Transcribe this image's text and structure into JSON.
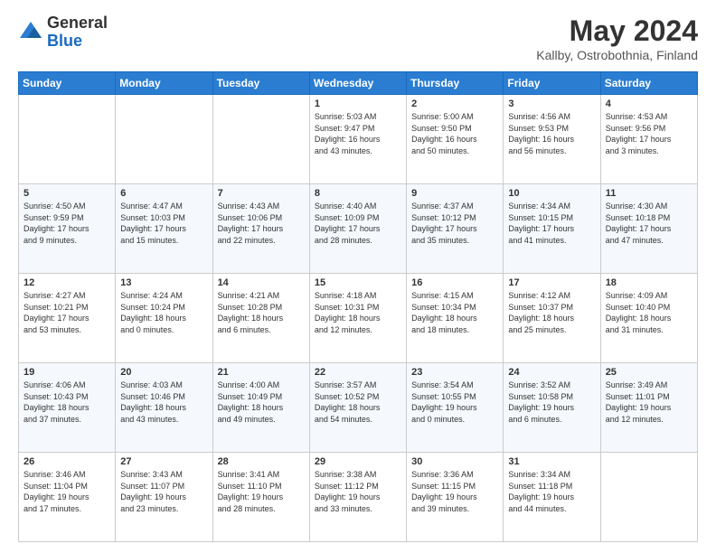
{
  "logo": {
    "general": "General",
    "blue": "Blue"
  },
  "title": "May 2024",
  "subtitle": "Kallby, Ostrobothnia, Finland",
  "days_of_week": [
    "Sunday",
    "Monday",
    "Tuesday",
    "Wednesday",
    "Thursday",
    "Friday",
    "Saturday"
  ],
  "weeks": [
    [
      {
        "day": "",
        "info": ""
      },
      {
        "day": "",
        "info": ""
      },
      {
        "day": "",
        "info": ""
      },
      {
        "day": "1",
        "info": "Sunrise: 5:03 AM\nSunset: 9:47 PM\nDaylight: 16 hours\nand 43 minutes."
      },
      {
        "day": "2",
        "info": "Sunrise: 5:00 AM\nSunset: 9:50 PM\nDaylight: 16 hours\nand 50 minutes."
      },
      {
        "day": "3",
        "info": "Sunrise: 4:56 AM\nSunset: 9:53 PM\nDaylight: 16 hours\nand 56 minutes."
      },
      {
        "day": "4",
        "info": "Sunrise: 4:53 AM\nSunset: 9:56 PM\nDaylight: 17 hours\nand 3 minutes."
      }
    ],
    [
      {
        "day": "5",
        "info": "Sunrise: 4:50 AM\nSunset: 9:59 PM\nDaylight: 17 hours\nand 9 minutes."
      },
      {
        "day": "6",
        "info": "Sunrise: 4:47 AM\nSunset: 10:03 PM\nDaylight: 17 hours\nand 15 minutes."
      },
      {
        "day": "7",
        "info": "Sunrise: 4:43 AM\nSunset: 10:06 PM\nDaylight: 17 hours\nand 22 minutes."
      },
      {
        "day": "8",
        "info": "Sunrise: 4:40 AM\nSunset: 10:09 PM\nDaylight: 17 hours\nand 28 minutes."
      },
      {
        "day": "9",
        "info": "Sunrise: 4:37 AM\nSunset: 10:12 PM\nDaylight: 17 hours\nand 35 minutes."
      },
      {
        "day": "10",
        "info": "Sunrise: 4:34 AM\nSunset: 10:15 PM\nDaylight: 17 hours\nand 41 minutes."
      },
      {
        "day": "11",
        "info": "Sunrise: 4:30 AM\nSunset: 10:18 PM\nDaylight: 17 hours\nand 47 minutes."
      }
    ],
    [
      {
        "day": "12",
        "info": "Sunrise: 4:27 AM\nSunset: 10:21 PM\nDaylight: 17 hours\nand 53 minutes."
      },
      {
        "day": "13",
        "info": "Sunrise: 4:24 AM\nSunset: 10:24 PM\nDaylight: 18 hours\nand 0 minutes."
      },
      {
        "day": "14",
        "info": "Sunrise: 4:21 AM\nSunset: 10:28 PM\nDaylight: 18 hours\nand 6 minutes."
      },
      {
        "day": "15",
        "info": "Sunrise: 4:18 AM\nSunset: 10:31 PM\nDaylight: 18 hours\nand 12 minutes."
      },
      {
        "day": "16",
        "info": "Sunrise: 4:15 AM\nSunset: 10:34 PM\nDaylight: 18 hours\nand 18 minutes."
      },
      {
        "day": "17",
        "info": "Sunrise: 4:12 AM\nSunset: 10:37 PM\nDaylight: 18 hours\nand 25 minutes."
      },
      {
        "day": "18",
        "info": "Sunrise: 4:09 AM\nSunset: 10:40 PM\nDaylight: 18 hours\nand 31 minutes."
      }
    ],
    [
      {
        "day": "19",
        "info": "Sunrise: 4:06 AM\nSunset: 10:43 PM\nDaylight: 18 hours\nand 37 minutes."
      },
      {
        "day": "20",
        "info": "Sunrise: 4:03 AM\nSunset: 10:46 PM\nDaylight: 18 hours\nand 43 minutes."
      },
      {
        "day": "21",
        "info": "Sunrise: 4:00 AM\nSunset: 10:49 PM\nDaylight: 18 hours\nand 49 minutes."
      },
      {
        "day": "22",
        "info": "Sunrise: 3:57 AM\nSunset: 10:52 PM\nDaylight: 18 hours\nand 54 minutes."
      },
      {
        "day": "23",
        "info": "Sunrise: 3:54 AM\nSunset: 10:55 PM\nDaylight: 19 hours\nand 0 minutes."
      },
      {
        "day": "24",
        "info": "Sunrise: 3:52 AM\nSunset: 10:58 PM\nDaylight: 19 hours\nand 6 minutes."
      },
      {
        "day": "25",
        "info": "Sunrise: 3:49 AM\nSunset: 11:01 PM\nDaylight: 19 hours\nand 12 minutes."
      }
    ],
    [
      {
        "day": "26",
        "info": "Sunrise: 3:46 AM\nSunset: 11:04 PM\nDaylight: 19 hours\nand 17 minutes."
      },
      {
        "day": "27",
        "info": "Sunrise: 3:43 AM\nSunset: 11:07 PM\nDaylight: 19 hours\nand 23 minutes."
      },
      {
        "day": "28",
        "info": "Sunrise: 3:41 AM\nSunset: 11:10 PM\nDaylight: 19 hours\nand 28 minutes."
      },
      {
        "day": "29",
        "info": "Sunrise: 3:38 AM\nSunset: 11:12 PM\nDaylight: 19 hours\nand 33 minutes."
      },
      {
        "day": "30",
        "info": "Sunrise: 3:36 AM\nSunset: 11:15 PM\nDaylight: 19 hours\nand 39 minutes."
      },
      {
        "day": "31",
        "info": "Sunrise: 3:34 AM\nSunset: 11:18 PM\nDaylight: 19 hours\nand 44 minutes."
      },
      {
        "day": "",
        "info": ""
      }
    ]
  ]
}
